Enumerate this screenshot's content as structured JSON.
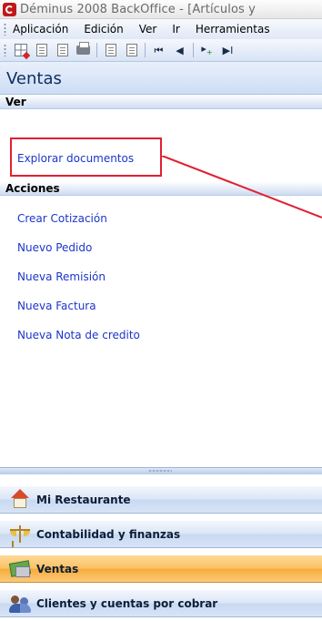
{
  "window": {
    "title": "Déminus 2008 BackOffice - [Artículos y"
  },
  "menubar": {
    "items": [
      {
        "label": "Aplicación"
      },
      {
        "label": "Edición"
      },
      {
        "label": "Ver"
      },
      {
        "label": "Ir"
      },
      {
        "label": "Herramientas"
      }
    ]
  },
  "toolbar": {
    "buttons": [
      {
        "icon": "grid-delete-icon"
      },
      {
        "icon": "document-lookup-icon"
      },
      {
        "icon": "print-preview-icon"
      },
      {
        "icon": "print-icon"
      },
      {
        "icon": "copy-icon"
      },
      {
        "icon": "paste-icon"
      },
      {
        "icon": "first-record-icon"
      },
      {
        "icon": "previous-record-icon"
      },
      {
        "icon": "new-record-icon"
      },
      {
        "icon": "last-record-icon"
      }
    ]
  },
  "panel": {
    "title": "Ventas",
    "sections": [
      {
        "title": "Ver",
        "links": [
          "Explorar documentos"
        ]
      },
      {
        "title": "Acciones",
        "links": [
          "Crear Cotización",
          "Nuevo Pedido",
          "Nueva Remisión",
          "Nueva Factura",
          "Nueva Nota de credito"
        ]
      }
    ]
  },
  "annotation": {
    "highlight_color": "#e02030"
  },
  "navigation": {
    "items": [
      {
        "label": "Mi Restaurante",
        "icon": "house-icon",
        "active": false
      },
      {
        "label": "Contabilidad y finanzas",
        "icon": "scale-icon",
        "active": false
      },
      {
        "label": "Ventas",
        "icon": "money-icon",
        "active": true
      },
      {
        "label": "Clientes y cuentas por cobrar",
        "icon": "people-icon",
        "active": false
      }
    ]
  }
}
